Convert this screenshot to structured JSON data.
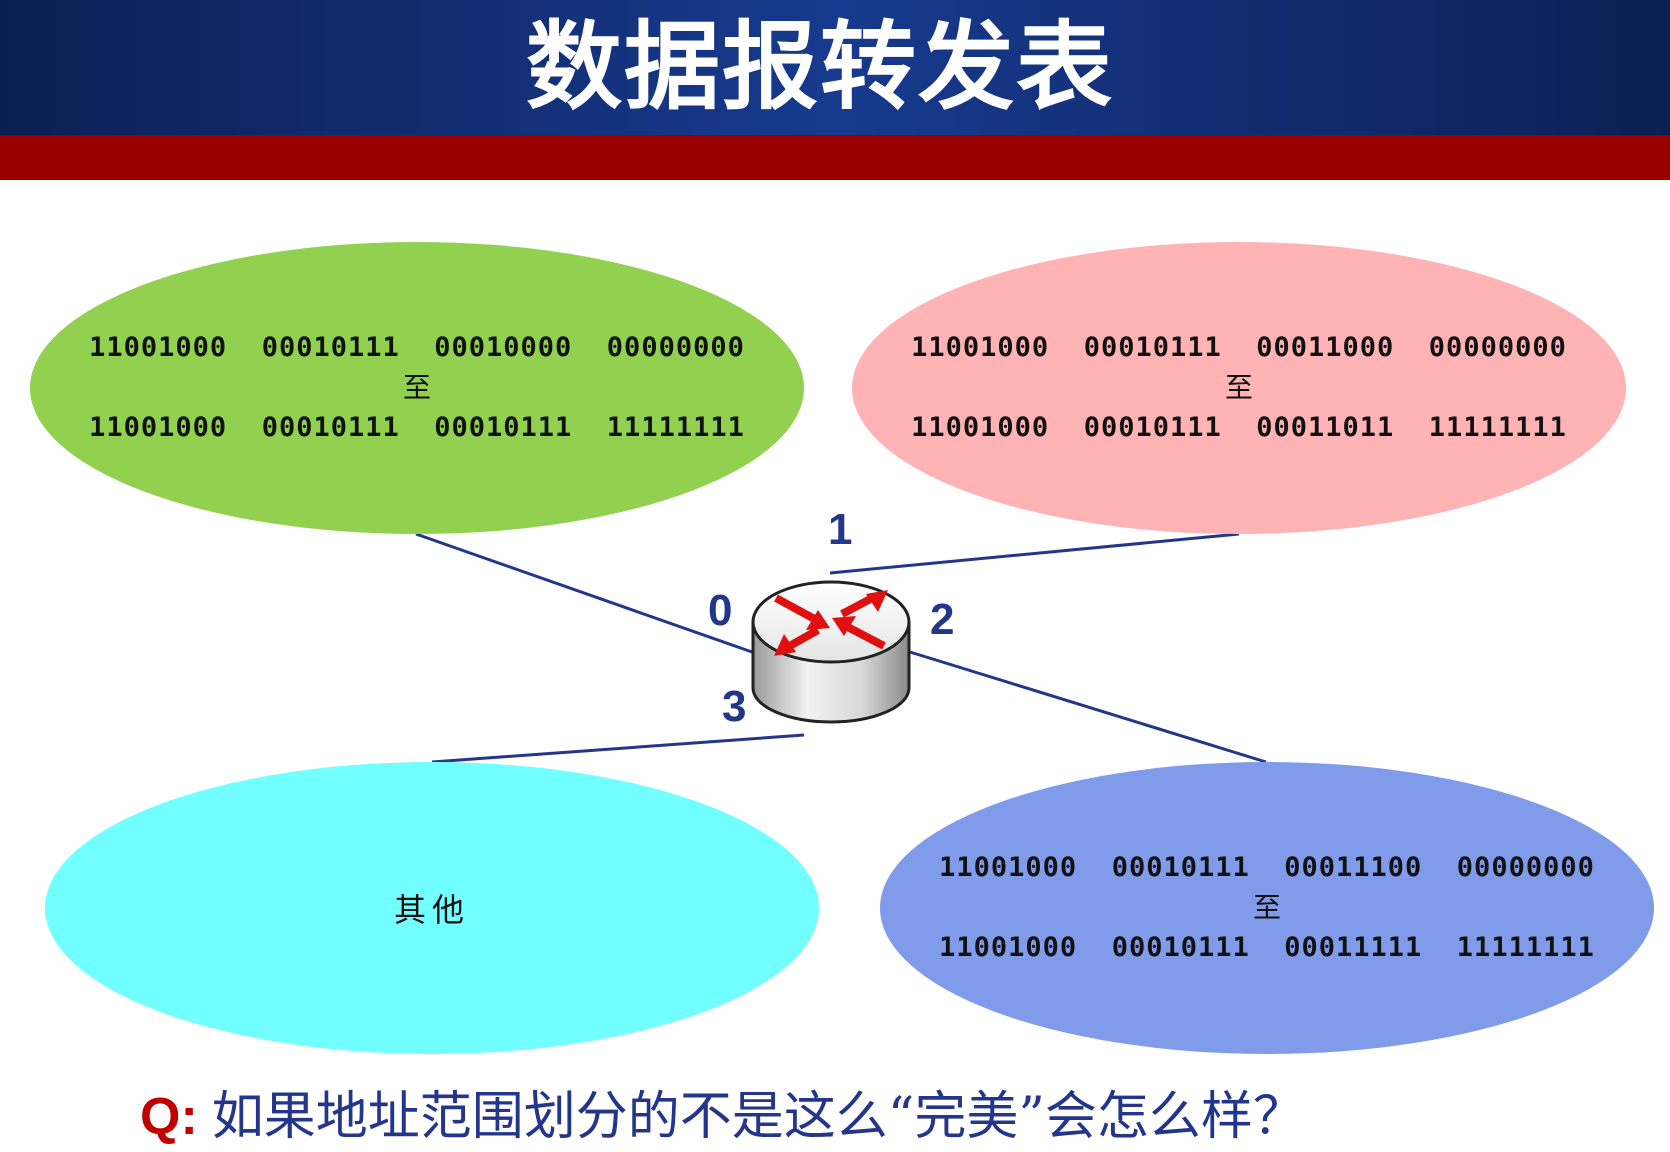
{
  "header": {
    "title": "数据报转发表",
    "band_color": "#173a8e",
    "accent_bar_color": "#990000"
  },
  "networks": [
    {
      "port": "0",
      "color": "#92d050",
      "range_start": "11001000  00010111  00010000  00000000",
      "to_word": "至",
      "range_end": "11001000  00010111  00010111  11111111"
    },
    {
      "port": "1",
      "color": "#ffb3b5",
      "range_start": "11001000  00010111  00011000  00000000",
      "to_word": "至",
      "range_end": "11001000  00010111  00011011  11111111"
    },
    {
      "port": "2",
      "color": "#7f9bea",
      "range_start": "11001000  00010111  00011100  00000000",
      "to_word": "至",
      "range_end": "11001000  00010111  00011111  11111111"
    },
    {
      "port": "3",
      "color": "#72ffff",
      "label": "其他"
    }
  ],
  "router": {
    "icon": "router-icon",
    "ports": [
      "0",
      "1",
      "2",
      "3"
    ]
  },
  "question": {
    "prefix": "Q:",
    "text": "如果地址范围划分的不是这么“完美”会怎么样？"
  }
}
